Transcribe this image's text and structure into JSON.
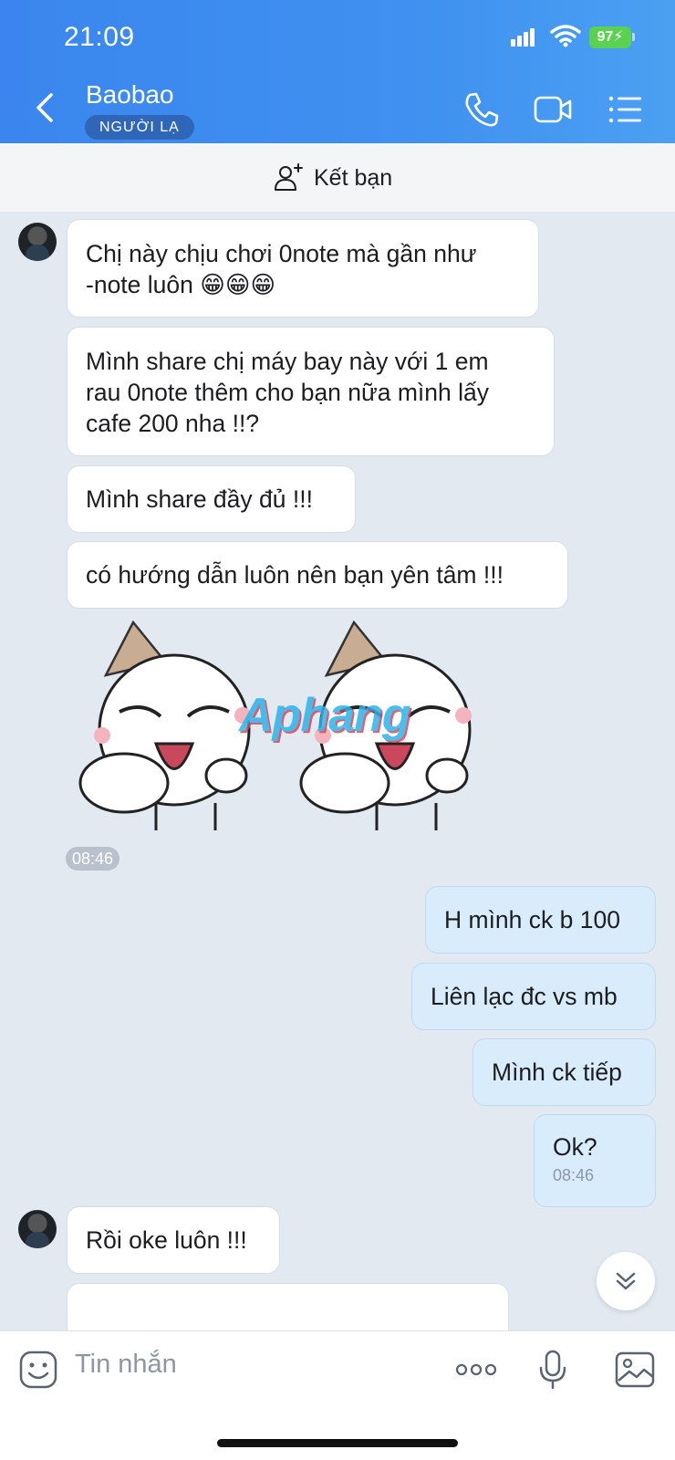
{
  "status_bar": {
    "time": "21:09",
    "battery": "97"
  },
  "header": {
    "contact_name": "Baobao",
    "badge": "NGƯỜI LẠ"
  },
  "add_friend": {
    "label": "Kết bạn"
  },
  "messages": {
    "m1": {
      "line1": "Chị này chịu chơi 0note mà gần như",
      "line2": "-note luôn 😁😁😁"
    },
    "m2": {
      "line1": "Mình share chị máy bay này với 1 em",
      "line2": "rau 0note thêm cho bạn nữa mình lấy",
      "line3": "cafe 200 nha !!?"
    },
    "m3": "Mình share đầy đủ !!!",
    "m4": "có hướng dẫn luôn nên bạn yên tâm !!!",
    "sticker_time": "08:46",
    "o1": "H mình ck b 100",
    "o2": "Liên lạc đc vs mb",
    "o3": "Mình ck tiếp",
    "o4": "Ok?",
    "o4_time": "08:46",
    "m5": "Rồi oke luôn !!!"
  },
  "watermark": "Aphang",
  "composer": {
    "placeholder": "Tin nhắn"
  },
  "colors": {
    "header_blue": "#3f90f0",
    "outgoing_bubble": "#d9ecfb",
    "chat_bg": "#e2e9f1"
  }
}
